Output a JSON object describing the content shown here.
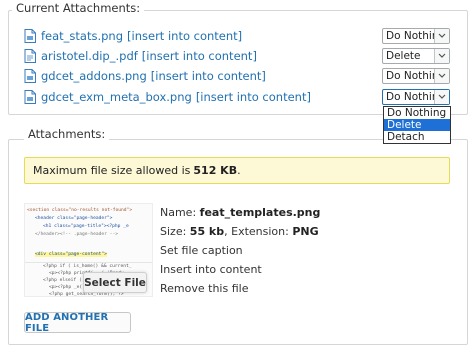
{
  "current_attachments": {
    "legend": "Current Attachments:",
    "files": [
      {
        "name": "feat_stats.png",
        "insert_label": "[insert into content]",
        "action": "Do Nothing"
      },
      {
        "name": "aristotel.dip_.pdf",
        "insert_label": "[insert into content]",
        "action": "Delete"
      },
      {
        "name": "gdcet_addons.png",
        "insert_label": "[insert into content]",
        "action": "Do Nothing"
      },
      {
        "name": "gdcet_exm_meta_box.png",
        "insert_label": "[insert into content]",
        "action": "Do Nothing"
      }
    ],
    "dropdown_options": [
      "Do Nothing",
      "Delete",
      "Detach"
    ],
    "highlighted_option": "Delete"
  },
  "attachments": {
    "legend": "Attachments:",
    "notice_prefix": "Maximum file size allowed is",
    "notice_size": "512 KB",
    "notice_suffix": ".",
    "name_label": "Name:",
    "name_value": "feat_templates.png",
    "size_label": "Size:",
    "size_value": "55 kb",
    "ext_label": ", Extension:",
    "ext_value": "PNG",
    "set_caption": "Set file caption",
    "insert_into_content": "Insert into content",
    "remove_file": "Remove this file",
    "select_file": "Select File",
    "add_another": "ADD ANOTHER FILE"
  },
  "thumbnail_code": [
    "<section class=\"no-results not-found\">",
    "<header class=\"page-header\">",
    "<h1 class=\"page-title\"><?php _e",
    "</header><!-- .page-header -->",
    "<div class=\"page-content\">",
    "<?php if ( is_home() && current_",
    "<p><?php printf( __( 'Ready",
    "<?php elseif ( is_search() ) :",
    "<p><?php _e( 'Sorry, but",
    "<?php get_search_form(); ?>"
  ],
  "colors": {
    "link": "#2271b1",
    "notice_bg": "#fdf9d6",
    "notice_border": "#e6db55",
    "highlight": "#1e70d6"
  }
}
